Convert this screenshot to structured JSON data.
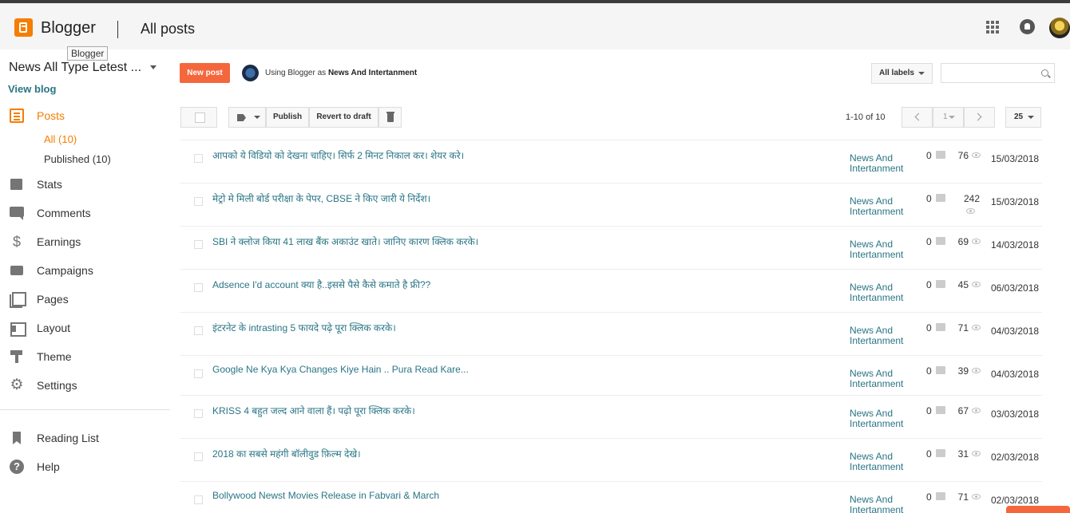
{
  "header": {
    "brand": "Blogger",
    "page_title": "All posts",
    "tooltip": "Blogger"
  },
  "sidebar": {
    "blog_name": "News All Type Letest ...",
    "view_blog": "View blog",
    "items": [
      {
        "label": "Posts",
        "icon": "posts-icon"
      },
      {
        "label": "Stats",
        "icon": "stats-icon"
      },
      {
        "label": "Comments",
        "icon": "comments-icon"
      },
      {
        "label": "Earnings",
        "icon": "earnings-icon"
      },
      {
        "label": "Campaigns",
        "icon": "campaigns-icon"
      },
      {
        "label": "Pages",
        "icon": "pages-icon"
      },
      {
        "label": "Layout",
        "icon": "layout-icon"
      },
      {
        "label": "Theme",
        "icon": "theme-icon"
      },
      {
        "label": "Settings",
        "icon": "settings-icon"
      }
    ],
    "sub_items": [
      {
        "label": "All (10)"
      },
      {
        "label": "Published (10)"
      }
    ],
    "bottom_items": [
      {
        "label": "Reading List",
        "icon": "reading-list-icon"
      },
      {
        "label": "Help",
        "icon": "help-icon"
      }
    ],
    "earnings_glyph": "$",
    "settings_glyph": "⚙"
  },
  "toolbar": {
    "new_post": "New post",
    "using_prefix": "Using Blogger as ",
    "using_name": "News And Intertanment",
    "all_labels": "All labels",
    "search_placeholder": "",
    "publish": "Publish",
    "revert": "Revert to draft",
    "pager_text": "1-10 of 10",
    "page_number": "1",
    "per_page": "25"
  },
  "colors": {
    "accent": "#f57d00",
    "new_post_button": "#f4673c",
    "link": "#2a7585"
  },
  "posts": [
    {
      "title": "आपको ये विडियो को देखना चाहिए। सिर्फ 2 मिनट निकाल कर। शेयर करे।",
      "label": "News And Intertanment",
      "comments": "0",
      "views": "76",
      "date": "15/03/2018"
    },
    {
      "title": "मेट्रो मे मिली बोर्ड परीक्षा के पेपर, CBSE ने किए जारी ये निर्देश।",
      "label": "News And Intertanment",
      "comments": "0",
      "views": "242",
      "date": "15/03/2018"
    },
    {
      "title": "SBI ने क्लोज किया 41 लाख बैंक अकाउंट खाते। जानिए कारण क्लिक करके।",
      "label": "News And Intertanment",
      "comments": "0",
      "views": "69",
      "date": "14/03/2018"
    },
    {
      "title": "Adsence I'd account क्या है..इससे पैसे कैसे कमाते है फ्री??",
      "label": "News And Intertanment",
      "comments": "0",
      "views": "45",
      "date": "06/03/2018"
    },
    {
      "title": "इंटरनेट के intrasting 5 फायदे पढ़े पूरा क्लिक करके।",
      "label": "News And Intertanment",
      "comments": "0",
      "views": "71",
      "date": "04/03/2018"
    },
    {
      "title": "Google Ne Kya Kya Changes Kiye Hain .. Pura Read Kare...",
      "label": "News And Intertanment",
      "comments": "0",
      "views": "39",
      "date": "04/03/2018"
    },
    {
      "title": "KRISS 4 बहुत जल्द आने वाला हैं। पढ़ो पूरा क्लिक करके।",
      "label": "News And Intertanment",
      "comments": "0",
      "views": "67",
      "date": "03/03/2018"
    },
    {
      "title": "2018 का सबसे महंगी बॉलीवुड फ़िल्म देखे।",
      "label": "News And Intertanment",
      "comments": "0",
      "views": "31",
      "date": "02/03/2018"
    },
    {
      "title": "Bollywood Newst Movies Release in Fabvari & March",
      "label": "News And Intertanment",
      "comments": "0",
      "views": "71",
      "date": "02/03/2018"
    }
  ]
}
